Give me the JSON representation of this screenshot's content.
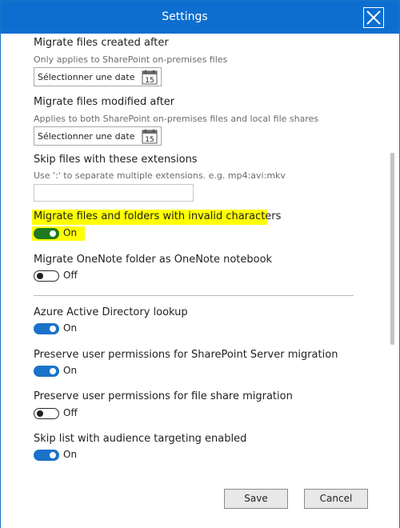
{
  "window": {
    "title": "Settings"
  },
  "sections": {
    "created_after": {
      "label": "Migrate files created after",
      "hint": "Only applies to SharePoint on-premises files",
      "date_placeholder": "Sélectionner une date",
      "calendar_day": "15"
    },
    "modified_after": {
      "label": "Migrate files modified after",
      "hint": "Applies to both SharePoint on-premises files and local file shares",
      "date_placeholder": "Sélectionner une date",
      "calendar_day": "15"
    },
    "skip_extensions": {
      "label": "Skip files with these extensions",
      "hint": "Use ':' to separate multiple extensions. e.g. mp4:avi:mkv",
      "value": ""
    },
    "invalid_chars": {
      "label": "Migrate files and folders with invalid characters",
      "state": "On"
    },
    "onenote": {
      "label": "Migrate OneNote folder as OneNote notebook",
      "state": "Off"
    },
    "aad_lookup": {
      "label": "Azure Active Directory lookup",
      "state": "On"
    },
    "sp_permissions": {
      "label": "Preserve user permissions for SharePoint Server migration",
      "state": "On"
    },
    "fs_permissions": {
      "label": "Preserve user permissions for file share migration",
      "state": "Off"
    },
    "audience_targeting": {
      "label": "Skip list with audience targeting enabled",
      "state": "On"
    }
  },
  "highlight_color": "#ffff00",
  "accent_color": "#1a73c9",
  "footer": {
    "save_label": "Save",
    "cancel_label": "Cancel"
  }
}
